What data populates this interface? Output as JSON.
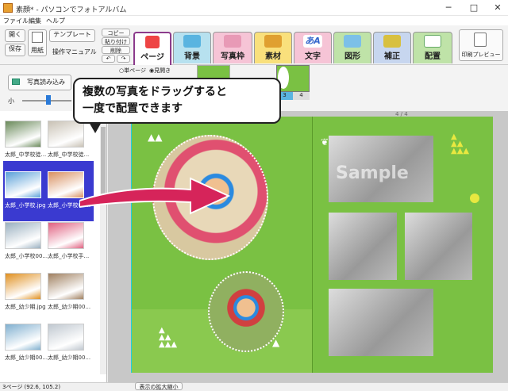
{
  "window": {
    "title": "素顔* - パソコンでフォトアルバム",
    "min": "─",
    "max": "□",
    "close": "✕"
  },
  "menu": [
    "ファイル",
    "編集",
    "ヘルプ"
  ],
  "toolbar": {
    "open": "開く",
    "save": "保存",
    "paper": "用紙",
    "template": "テンプレート",
    "manual": "操作マニュアル",
    "copy": "コピー",
    "paste": "貼り付け",
    "delete": "削除",
    "undo": "↶",
    "redo": "↷",
    "print_preview": "印刷プレビュー"
  },
  "tabs": [
    {
      "label": "ページ",
      "color": "#ffffff"
    },
    {
      "label": "背景",
      "color": "#b7e1ef"
    },
    {
      "label": "写真枠",
      "color": "#f6c4d6"
    },
    {
      "label": "素材",
      "color": "#f9e07c"
    },
    {
      "label": "文字",
      "color": "#f6c4d6"
    },
    {
      "label": "図形",
      "color": "#bfe3a8"
    },
    {
      "label": "補正",
      "color": "#c7d6ef"
    },
    {
      "label": "配置",
      "color": "#bfe3a8"
    }
  ],
  "subbar": {
    "load_photos": "写真読み込み",
    "view_single": "単ページ",
    "view_spread": "見開き",
    "zoom_small": "小",
    "pages": [
      "3",
      "4"
    ]
  },
  "callout": {
    "line1": "複数の写真をドラッグすると",
    "line2": "一度で配置できます"
  },
  "canvas": {
    "page_indicator": "4 / 4",
    "watermark": "Sample"
  },
  "thumbnails": [
    {
      "label": "太郎_中学校徒...",
      "selected": false,
      "tone": "#6a8a5a"
    },
    {
      "label": "太郎_中学校徒...",
      "selected": false,
      "tone": "#c9c2b5"
    },
    {
      "label": "太郎_小学校.jpg",
      "selected": true,
      "tone": "#5aa0d8"
    },
    {
      "label": "太郎_小学校00...",
      "selected": true,
      "tone": "#d89060"
    },
    {
      "label": "太郎_小学校00...",
      "selected": false,
      "tone": "#9ab0c0"
    },
    {
      "label": "太郎_小学校手...",
      "selected": false,
      "tone": "#e06080"
    },
    {
      "label": "太郎_幼少期.jpg",
      "selected": false,
      "tone": "#e09020"
    },
    {
      "label": "太郎_幼少期00...",
      "selected": false,
      "tone": "#a08060"
    },
    {
      "label": "太郎_幼少期00...",
      "selected": false,
      "tone": "#80b0d0"
    },
    {
      "label": "太郎_幼少期00...",
      "selected": false,
      "tone": "#c0c8d0"
    }
  ],
  "status": {
    "coords": "3ページ (92.6, 105.2)",
    "zoom_button": "表示の拡大縮小"
  },
  "colors": {
    "accent": "#8c3b8c",
    "page_green": "#7ac143",
    "arrow": "#d6245a",
    "selection": "#3a3ad0"
  }
}
